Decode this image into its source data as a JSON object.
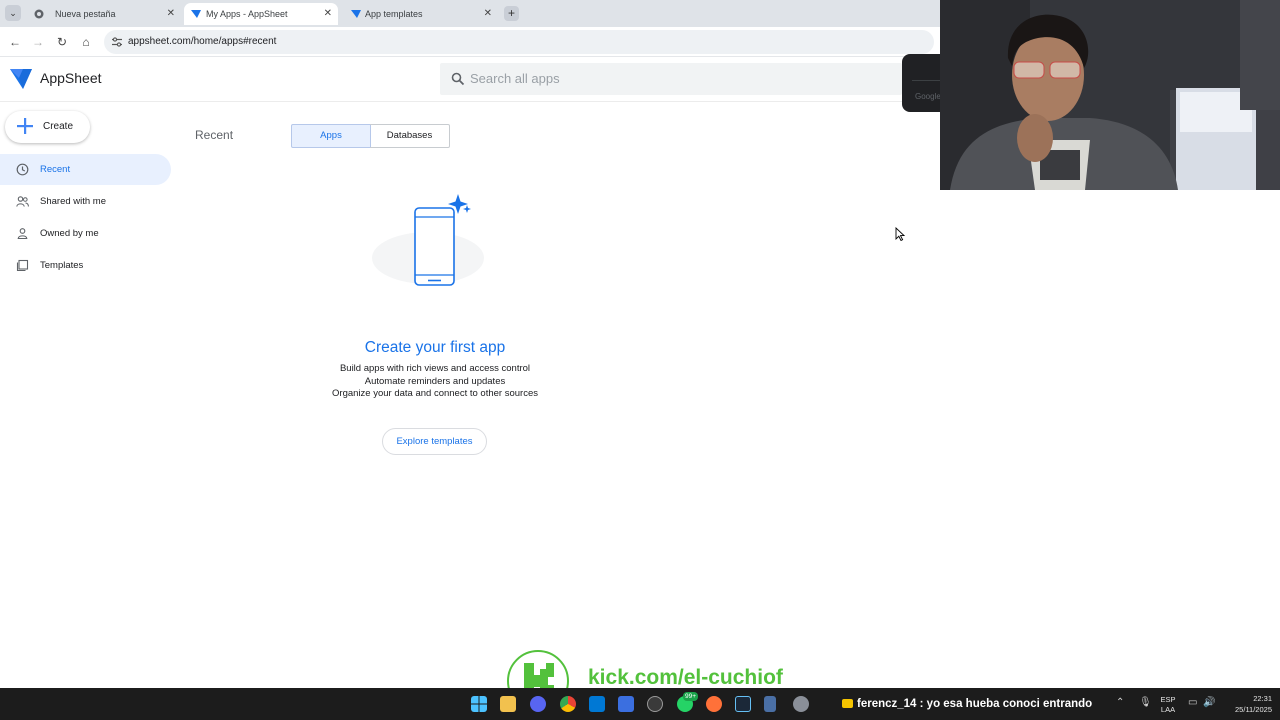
{
  "browser": {
    "tabs": [
      {
        "title": "Nueva pestaña"
      },
      {
        "title": "My Apps - AppSheet"
      },
      {
        "title": "App templates"
      }
    ],
    "url": "appsheet.com/home/apps#recent"
  },
  "app": {
    "brand": "AppSheet",
    "search_placeholder": "Search all apps",
    "popup_text": "Google"
  },
  "sidebar": {
    "create_label": "Create",
    "items": [
      {
        "label": "Recent",
        "icon": "clock-icon"
      },
      {
        "label": "Shared with me",
        "icon": "people-icon"
      },
      {
        "label": "Owned by me",
        "icon": "person-icon"
      },
      {
        "label": "Templates",
        "icon": "templates-icon"
      }
    ]
  },
  "main": {
    "section_title": "Recent",
    "tabs": [
      "Apps",
      "Databases"
    ],
    "empty_state": {
      "title": "Create your first app",
      "lines": [
        "Build apps with rich views and access control",
        "Automate reminders and updates",
        "Organize your data and connect to other sources"
      ],
      "button": "Explore templates"
    }
  },
  "overlay": {
    "kick_url": "kick.com/el-cuchiof"
  },
  "taskbar": {
    "chat_message": "ferencz_14 : yo esa hueba conoci entrando",
    "whatsapp_badge": "99+",
    "lang_top": "ESP",
    "lang_bottom": "LAA",
    "time": "22:31",
    "date": "25/11/2025"
  },
  "colors": {
    "accent": "#1a73e8",
    "selected_bg": "#e8f0fe",
    "kick_green": "#53c13c",
    "taskbar": "#1c1c1c"
  }
}
